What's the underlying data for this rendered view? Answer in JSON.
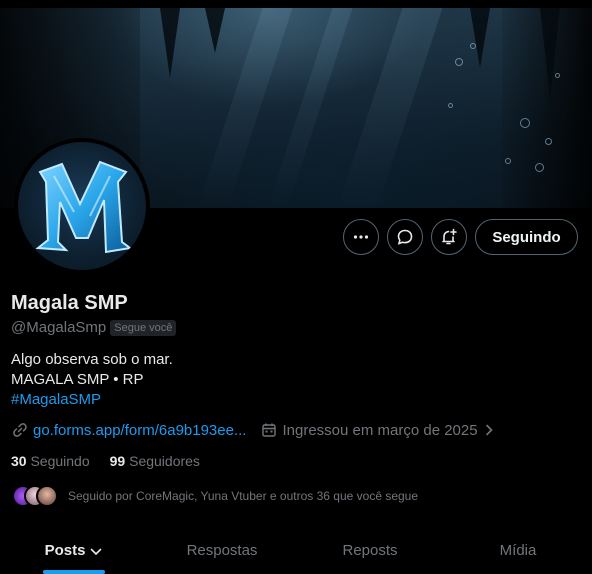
{
  "profile": {
    "display_name": "Magala SMP",
    "handle": "@MagalaSmp",
    "follows_you_badge": "Segue você",
    "bio_line1": "Algo observa sob o mar.",
    "bio_line2": "MAGALA SMP • RP",
    "bio_hashtag": "#MagalaSMP",
    "link": "go.forms.app/form/6a9b193ee...",
    "joined": "Ingressou em março de 2025",
    "following_count": "30",
    "following_label": "Seguindo",
    "followers_count": "99",
    "followers_label": "Seguidores",
    "followed_by": "Seguido por CoreMagic, Yuna Vtuber e outros 36 que você segue"
  },
  "actions": {
    "more_icon": "more-icon",
    "message_icon": "message-icon",
    "notify_icon": "bell-plus-icon",
    "follow_button_label": "Seguindo"
  },
  "tabs": [
    {
      "label": "Posts",
      "active": true
    },
    {
      "label": "Respostas",
      "active": false
    },
    {
      "label": "Reposts",
      "active": false
    },
    {
      "label": "Mídia",
      "active": false
    }
  ],
  "colors": {
    "background": "#000000",
    "accent": "#1d9bf0",
    "text": "#e7e9ea",
    "muted": "#71767b",
    "border": "#536471"
  }
}
